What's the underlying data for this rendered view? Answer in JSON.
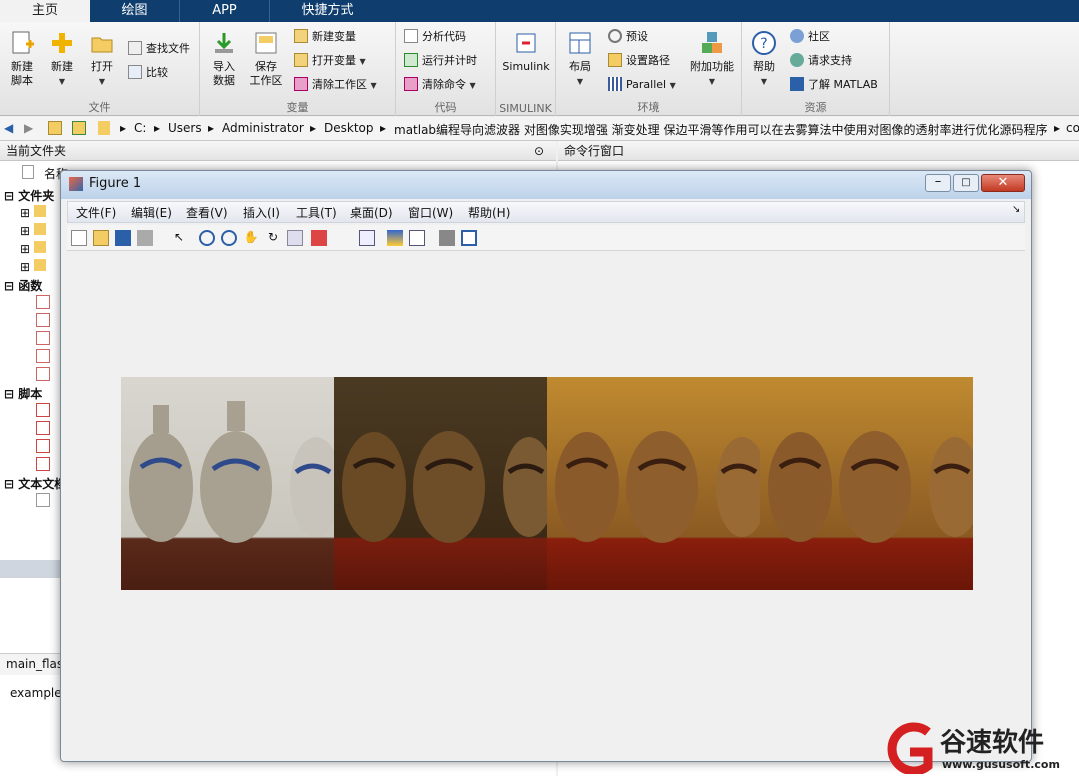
{
  "tabs": [
    "主页",
    "绘图",
    "APP",
    "快捷方式"
  ],
  "ribbon": {
    "file": {
      "new_script": "新建\n脚本",
      "new": "新建",
      "open": "打开",
      "find_files": "查找文件",
      "compare": "比较",
      "group": "文件"
    },
    "variable": {
      "import": "导入\n数据",
      "save_ws": "保存\n工作区",
      "new_var": "新建变量",
      "open_var": "打开变量",
      "clear_ws": "清除工作区",
      "group": "变量"
    },
    "code": {
      "analyze": "分析代码",
      "run_time": "运行并计时",
      "clear_cmd": "清除命令",
      "group": "代码"
    },
    "simulink": {
      "label": "Simulink",
      "group": "SIMULINK"
    },
    "env": {
      "layout": "布局",
      "prefs": "预设",
      "set_path": "设置路径",
      "parallel": "Parallel",
      "addons": "附加功能",
      "group": "环境"
    },
    "res": {
      "help": "帮助",
      "community": "社区",
      "support": "请求支持",
      "learn": "了解 MATLAB",
      "group": "资源"
    }
  },
  "address": [
    "C:",
    "Users",
    "Administrator",
    "Desktop",
    "matlab编程导向滤波器 对图像实现增强 渐变处理 保边平滑等作用可以在去雾算法中使用对图像的透射率进行优化源码程序",
    "co"
  ],
  "left_panel": {
    "title": "当前文件夹",
    "col_name": "名称",
    "sections": [
      "文件夹",
      "函数",
      "脚本",
      "文本文档"
    ],
    "bottom_tab": "main_flas",
    "bottom_text": "example"
  },
  "cmd_panel": {
    "title": "命令行窗口"
  },
  "figure": {
    "title": "Figure 1",
    "menus": [
      "文件(F)",
      "编辑(E)",
      "查看(V)",
      "插入(I)",
      "工具(T)",
      "桌面(D)",
      "窗口(W)",
      "帮助(H)"
    ]
  },
  "watermark": {
    "brand": "谷速软件",
    "url": "www.gususoft.com"
  }
}
